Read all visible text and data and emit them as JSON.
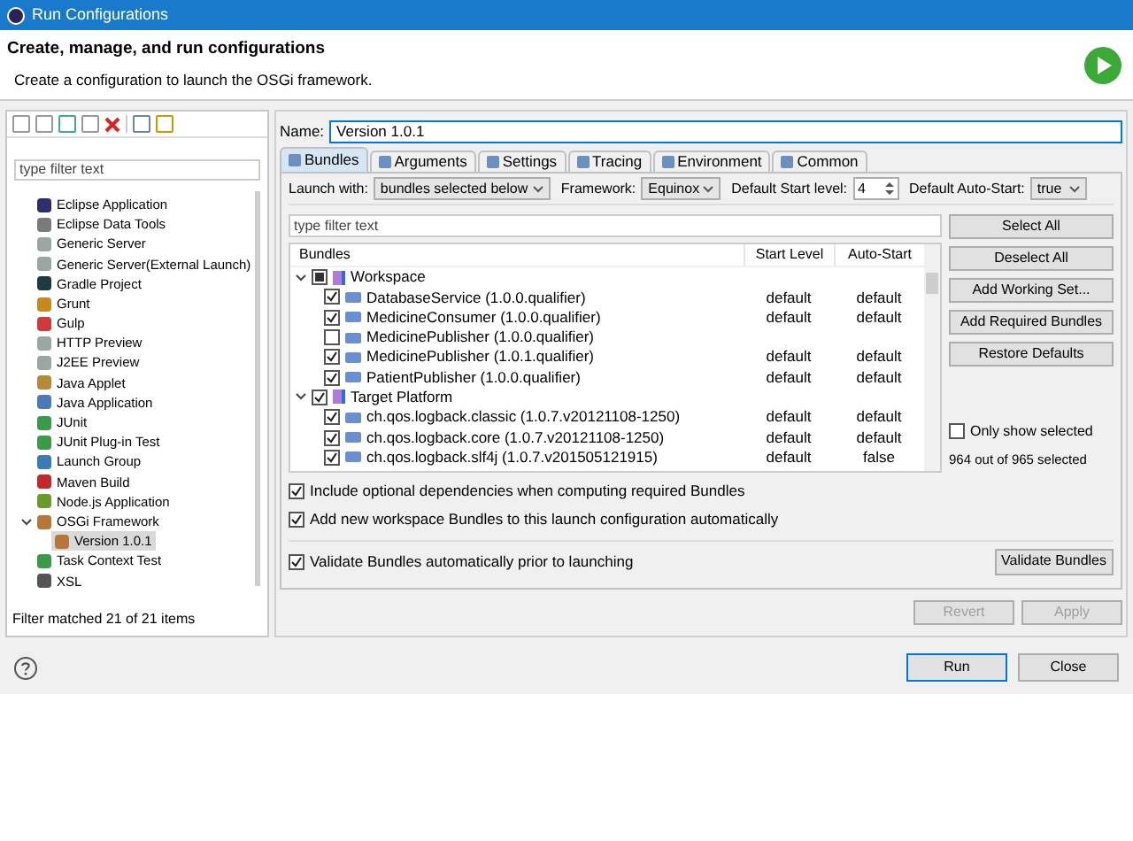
{
  "window": {
    "title": "Run Configurations"
  },
  "header": {
    "title": "Create, manage, and run configurations",
    "subtitle": "Create a configuration to launch the OSGi framework."
  },
  "left": {
    "filter_placeholder": "type filter text",
    "items": [
      {
        "label": "Eclipse Application",
        "color": "#2c2f6b",
        "selected": false
      },
      {
        "label": "Eclipse Data Tools",
        "color": "#7a7a7a",
        "selected": false
      },
      {
        "label": "Generic Server",
        "color": "#9aa6a0",
        "selected": false
      },
      {
        "label": "Generic Server(External Launch)",
        "color": "#9aa6a0",
        "selected": false
      },
      {
        "label": "Gradle Project",
        "color": "#1f3b3f",
        "selected": false
      },
      {
        "label": "Grunt",
        "color": "#c48a1b",
        "selected": false
      },
      {
        "label": "Gulp",
        "color": "#cf3a3a",
        "selected": false
      },
      {
        "label": "HTTP Preview",
        "color": "#9aa6a0",
        "selected": false
      },
      {
        "label": "J2EE Preview",
        "color": "#9aa6a0",
        "selected": false
      },
      {
        "label": "Java Applet",
        "color": "#b58a3a",
        "selected": false
      },
      {
        "label": "Java Application",
        "color": "#4a7ab8",
        "selected": false
      },
      {
        "label": "JUnit",
        "color": "#3a9a4a",
        "selected": false
      },
      {
        "label": "JUnit Plug-in Test",
        "color": "#3a9a4a",
        "selected": false
      },
      {
        "label": "Launch Group",
        "color": "#3a7ab8",
        "selected": false
      },
      {
        "label": "Maven Build",
        "color": "#c0282e",
        "selected": false
      },
      {
        "label": "Node.js Application",
        "color": "#6a9a2a",
        "selected": false
      },
      {
        "label": "OSGi Framework",
        "color": "#b8763a",
        "selected": false,
        "expanded": true,
        "children": [
          {
            "label": "Version 1.0.1",
            "color": "#b8763a",
            "selected": true
          }
        ]
      },
      {
        "label": "Task Context Test",
        "color": "#3a9a4a",
        "selected": false
      },
      {
        "label": "XSL",
        "color": "#555555",
        "selected": false
      }
    ],
    "status": "Filter matched 21 of 21 items"
  },
  "name": {
    "label": "Name:",
    "value": "Version 1.0.1"
  },
  "tabs": [
    {
      "label": "Bundles",
      "selected": true
    },
    {
      "label": "Arguments",
      "selected": false
    },
    {
      "label": "Settings",
      "selected": false
    },
    {
      "label": "Tracing",
      "selected": false
    },
    {
      "label": "Environment",
      "selected": false
    },
    {
      "label": "Common",
      "selected": false
    }
  ],
  "launch": {
    "launch_with_label": "Launch with:",
    "launch_with": "bundles selected below",
    "framework_label": "Framework:",
    "framework": "Equinox",
    "start_level_label": "Default Start level:",
    "start_level": "4",
    "auto_start_label": "Default Auto-Start:",
    "auto_start": "true"
  },
  "bundles": {
    "filter_placeholder": "type filter text",
    "columns": [
      "Bundles",
      "Start Level",
      "Auto-Start"
    ],
    "groups": [
      {
        "name": "Workspace",
        "expanded": true,
        "checked": true,
        "partial": true,
        "children": [
          {
            "name": "DatabaseService (1.0.0.qualifier)",
            "checked": true,
            "start_level": "default",
            "auto_start": "default"
          },
          {
            "name": "MedicineConsumer (1.0.0.qualifier)",
            "checked": true,
            "start_level": "default",
            "auto_start": "default"
          },
          {
            "name": "MedicinePublisher (1.0.0.qualifier)",
            "checked": false
          },
          {
            "name": "MedicinePublisher (1.0.1.qualifier)",
            "checked": true,
            "start_level": "default",
            "auto_start": "default"
          },
          {
            "name": "PatientPublisher (1.0.0.qualifier)",
            "checked": true,
            "start_level": "default",
            "auto_start": "default"
          }
        ]
      },
      {
        "name": "Target Platform",
        "expanded": true,
        "checked": true,
        "partial": false,
        "children": [
          {
            "name": "ch.qos.logback.classic (1.0.7.v20121108-1250)",
            "checked": true,
            "start_level": "default",
            "auto_start": "default"
          },
          {
            "name": "ch.qos.logback.core (1.0.7.v20121108-1250)",
            "checked": true,
            "start_level": "default",
            "auto_start": "default"
          },
          {
            "name": "ch.qos.logback.slf4j (1.0.7.v201505121915)",
            "checked": true,
            "start_level": "default",
            "auto_start": "false"
          }
        ]
      }
    ]
  },
  "side_buttons": [
    "Select All",
    "Deselect All",
    "Add Working Set...",
    "Add Required Bundles",
    "Restore Defaults"
  ],
  "only_show_selected": {
    "label": "Only show selected",
    "checked": false
  },
  "selection_count": "964 out of 965 selected",
  "options": [
    {
      "label": "Include optional dependencies when computing required Bundles",
      "checked": true
    },
    {
      "label": "Add new workspace Bundles to this launch configuration automatically",
      "checked": true
    }
  ],
  "validate": {
    "label": "Validate Bundles automatically prior to launching",
    "checked": true,
    "button": "Validate Bundles"
  },
  "actions": [
    {
      "label": "Revert",
      "disabled": true
    },
    {
      "label": "Apply",
      "disabled": true
    }
  ],
  "footer_buttons": [
    {
      "label": "Run",
      "default": true
    },
    {
      "label": "Close",
      "default": false
    }
  ]
}
